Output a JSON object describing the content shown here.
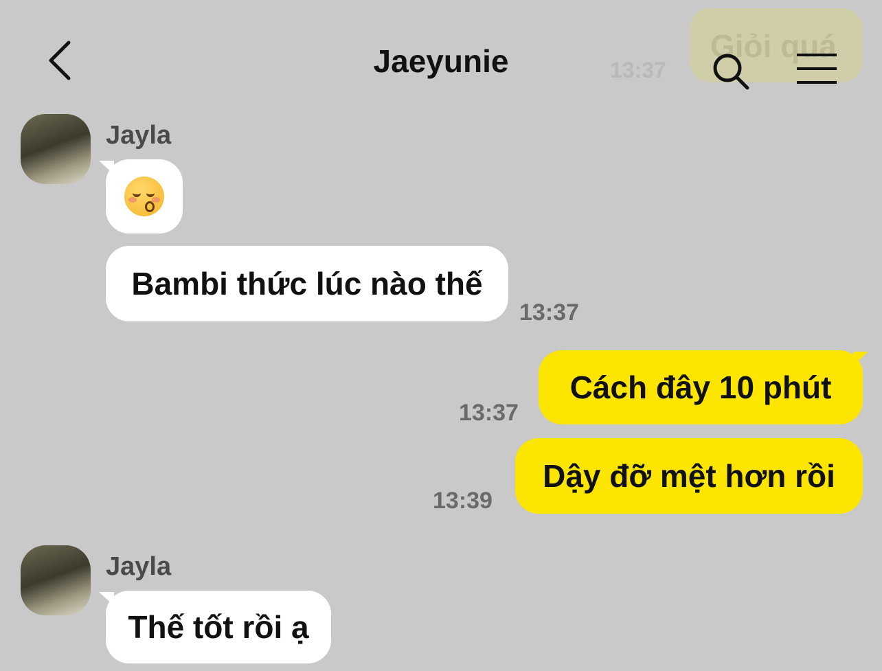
{
  "header": {
    "title": "Jaeyunie",
    "back_icon": "chevron-left-icon",
    "search_icon": "search-icon",
    "menu_icon": "hamburger-menu-icon"
  },
  "background_message": {
    "text": "Giỏi quá",
    "time": "13:37"
  },
  "messages": [
    {
      "sender": "Jayla",
      "direction": "incoming",
      "type": "emoji",
      "icon": "kissing-face-closed-eyes-emoji"
    },
    {
      "sender": "Jayla",
      "direction": "incoming",
      "text": "Bambi thức lúc nào thế",
      "time": "13:37"
    },
    {
      "direction": "outgoing",
      "text": "Cách đây 10 phút",
      "time": "13:37"
    },
    {
      "direction": "outgoing",
      "text": "Dậy đỡ mệt hơn rồi",
      "time": "13:39"
    },
    {
      "sender": "Jayla",
      "direction": "incoming",
      "text": "Thế tốt rồi ạ"
    }
  ],
  "colors": {
    "background": "#c9c9c9",
    "incoming_bubble": "#ffffff",
    "outgoing_bubble": "#fce500"
  }
}
